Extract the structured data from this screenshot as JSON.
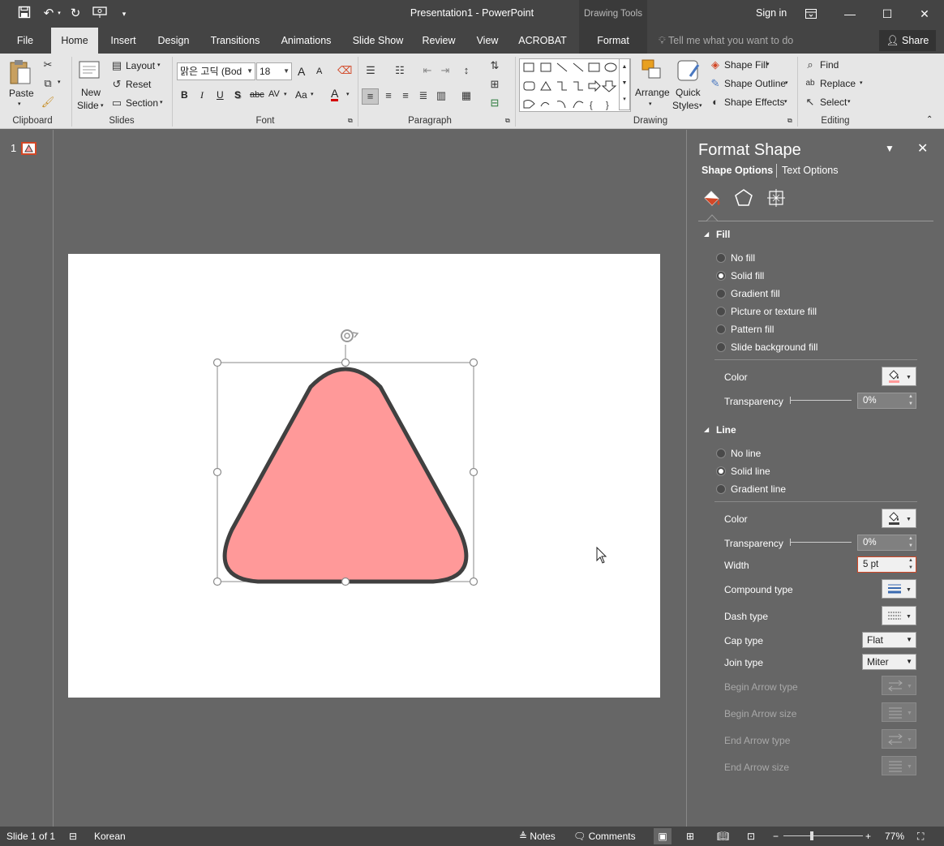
{
  "app": {
    "document_title": "Presentation1 - PowerPoint",
    "contextual_tab_group": "Drawing Tools",
    "sign_in": "Sign in",
    "share": "Share"
  },
  "qat": {
    "save_icon": "save-icon",
    "undo_icon": "undo-icon",
    "redo_icon": "redo-icon",
    "present_icon": "present-from-start-icon",
    "customize_icon": "customize-qat-icon"
  },
  "window_buttons": {
    "ribbon_display": "ribbon-display-options-icon",
    "minimize": "minimize-icon",
    "restore": "maximize-icon",
    "close": "close-icon"
  },
  "tabs": [
    "File",
    "Home",
    "Insert",
    "Design",
    "Transitions",
    "Animations",
    "Slide Show",
    "Review",
    "View",
    "ACROBAT",
    "Format"
  ],
  "active_tab": "Home",
  "tell_me": "Tell me what you want to do",
  "ribbon": {
    "clipboard": {
      "label": "Clipboard",
      "paste": "Paste"
    },
    "slides": {
      "label": "Slides",
      "new_slide_1": "New",
      "new_slide_2": "Slide",
      "layout": "Layout",
      "reset": "Reset",
      "section": "Section"
    },
    "font": {
      "label": "Font",
      "font_name": "맑은 고딕 (Bod",
      "font_size": "18",
      "bold": "B",
      "italic": "I",
      "underline": "U",
      "shadow": "S",
      "strike": "abc",
      "spacing": "AV",
      "case": "Aa",
      "color": "A",
      "grow": "A",
      "shrink": "A"
    },
    "paragraph": {
      "label": "Paragraph"
    },
    "drawing": {
      "label": "Drawing",
      "arrange": "Arrange",
      "quick_styles_1": "Quick",
      "quick_styles_2": "Styles",
      "shape_fill": "Shape Fill",
      "shape_outline": "Shape Outline",
      "shape_effects": "Shape Effects"
    },
    "editing": {
      "label": "Editing",
      "find": "Find",
      "replace": "Replace",
      "select": "Select"
    }
  },
  "thumbnails": {
    "slide_number": "1"
  },
  "shape": {
    "fill": "#ff9999",
    "stroke": "#404040"
  },
  "format_pane": {
    "title": "Format Shape",
    "shape_options": "Shape Options",
    "text_options": "Text Options",
    "fill": {
      "heading": "Fill",
      "options": [
        "No fill",
        "Solid fill",
        "Gradient fill",
        "Picture or texture fill",
        "Pattern fill",
        "Slide background fill"
      ],
      "selected": 1,
      "color_label": "Color",
      "transparency_label": "Transparency",
      "transparency_value": "0%"
    },
    "line": {
      "heading": "Line",
      "options": [
        "No line",
        "Solid line",
        "Gradient line"
      ],
      "selected": 1,
      "color_label": "Color",
      "transparency_label": "Transparency",
      "transparency_value": "0%",
      "width_label": "Width",
      "width_value": "5 pt",
      "compound_label": "Compound type",
      "dash_label": "Dash type",
      "cap_label": "Cap type",
      "cap_value": "Flat",
      "join_label": "Join type",
      "join_value": "Miter",
      "begin_arrow_type": "Begin Arrow type",
      "begin_arrow_size": "Begin Arrow size",
      "end_arrow_type": "End Arrow type",
      "end_arrow_size": "End Arrow size"
    }
  },
  "status": {
    "slide_info": "Slide 1 of 1",
    "language": "Korean",
    "notes": "Notes",
    "comments": "Comments",
    "zoom": "77%"
  }
}
